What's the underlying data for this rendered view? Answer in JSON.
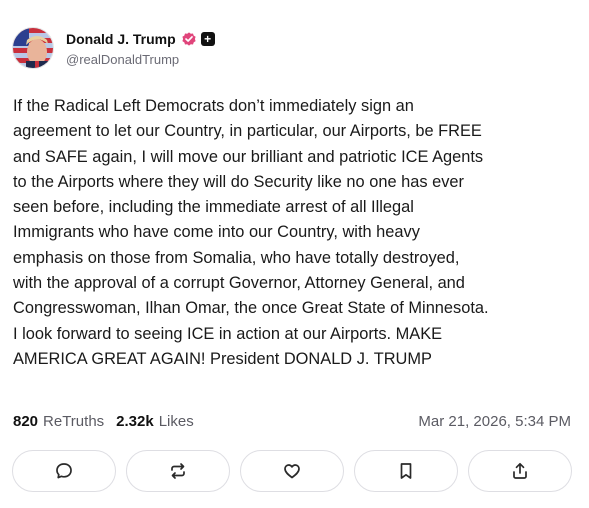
{
  "author": {
    "display_name": "Donald J. Trump",
    "handle": "@realDonaldTrump",
    "verified_color": "#e0457b"
  },
  "post": {
    "text": "If the Radical Left Democrats don’t immediately sign an\nagreement to let our Country, in particular, our Airports, be FREE\nand SAFE again, I will move our brilliant and patriotic ICE Agents\nto the Airports where they will do Security like no one has ever\nseen before, including the immediate arrest of all Illegal\nImmigrants who have come into our Country, with heavy\nemphasis on those from Somalia, who have totally destroyed,\nwith the approval of a corrupt Governor, Attorney General, and\nCongresswoman, Ilhan Omar, the once Great State of Minnesota.\nI look forward to seeing ICE in action at our Airports. MAKE\nAMERICA GREAT AGAIN! President DONALD J. TRUMP",
    "retruths_count": "820",
    "retruths_label": "ReTruths",
    "likes_count": "2.32k",
    "likes_label": "Likes",
    "timestamp": "Mar 21, 2026, 5:34 PM"
  },
  "actions": [
    {
      "icon": "comment-icon"
    },
    {
      "icon": "retruth-icon"
    },
    {
      "icon": "heart-icon"
    },
    {
      "icon": "bookmark-icon"
    },
    {
      "icon": "share-icon"
    }
  ]
}
